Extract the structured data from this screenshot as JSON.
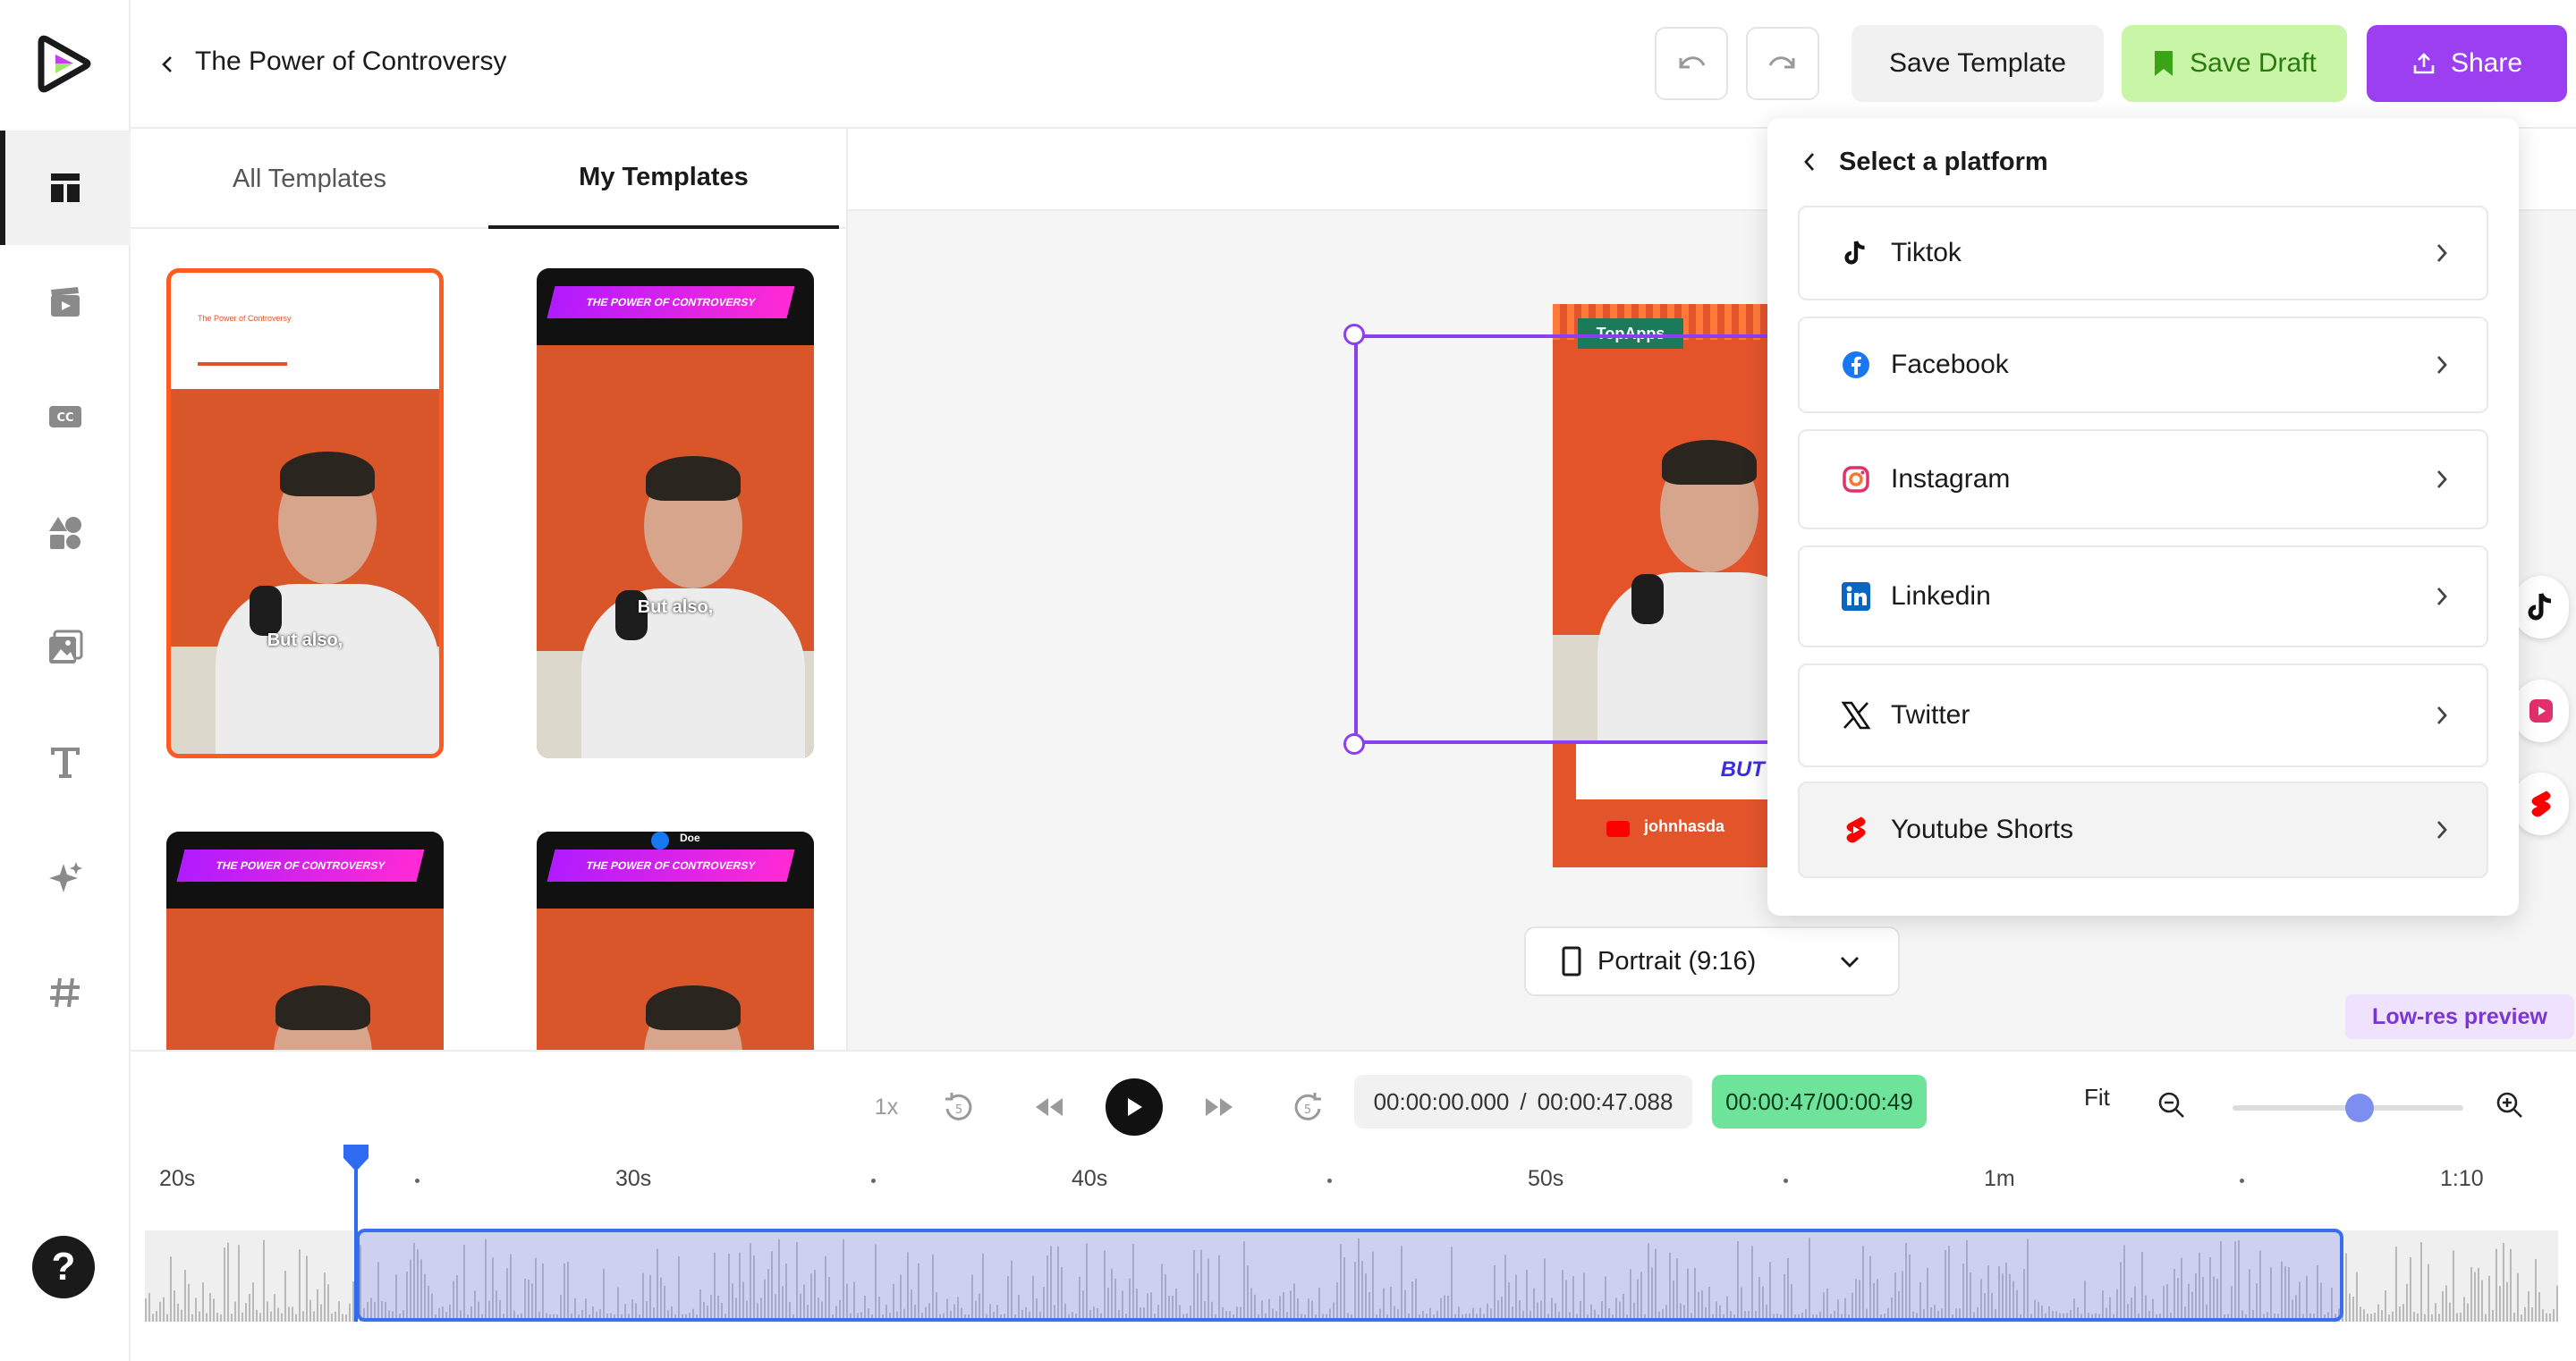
{
  "header": {
    "title": "The Power of Controversy",
    "save_template": "Save Template",
    "save_draft": "Save Draft",
    "share": "Share"
  },
  "sidebar": {
    "items": [
      "layout-icon",
      "media-clapper-icon",
      "captions-cc-icon",
      "elements-shapes-icon",
      "images-icon",
      "text-icon",
      "ai-sparkle-icon",
      "hashtag-icon"
    ],
    "help": "?"
  },
  "templates": {
    "tabs": [
      "All Templates",
      "My Templates"
    ],
    "active_tab": "My Templates",
    "cards": [
      {
        "title": "The Power of Controversy",
        "caption": "But also,"
      },
      {
        "title": "THE POWER OF CONTROVERSY",
        "caption": "But also,"
      },
      {
        "title": "THE POWER OF CONTROVERSY",
        "caption": ""
      },
      {
        "title": "THE POWER OF CONTROVERSY",
        "caption": "",
        "badge": "Doe"
      }
    ]
  },
  "preview": {
    "brand_tag": "TopApps",
    "caption": "BUT ALSO,",
    "channel": "johnhasda",
    "aspect": "Portrait (9:16)",
    "lowres": "Low-res preview"
  },
  "platform_menu": {
    "title": "Select a platform",
    "items": [
      {
        "label": "Tiktok",
        "icon": "tiktok-icon"
      },
      {
        "label": "Facebook",
        "icon": "facebook-icon"
      },
      {
        "label": "Instagram",
        "icon": "instagram-icon"
      },
      {
        "label": "Linkedin",
        "icon": "linkedin-icon"
      },
      {
        "label": "Twitter",
        "icon": "x-twitter-icon"
      },
      {
        "label": "Youtube Shorts",
        "icon": "youtube-shorts-icon"
      }
    ]
  },
  "timeline": {
    "speed": "1x",
    "current_time": "00:00:00.000",
    "separator": "/",
    "total_time": "00:00:47.088",
    "duration_badge": "00:00:47/00:00:49",
    "fit": "Fit",
    "zoom_level": 0.55,
    "ruler": [
      "20s",
      "30s",
      "40s",
      "50s",
      "1m",
      "1:10"
    ]
  },
  "colors": {
    "accent_purple": "#9b3ff0",
    "save_draft_bg": "#c9f5a7",
    "duration_green": "#6ee39a",
    "selection_blue": "#3a6ef0"
  }
}
